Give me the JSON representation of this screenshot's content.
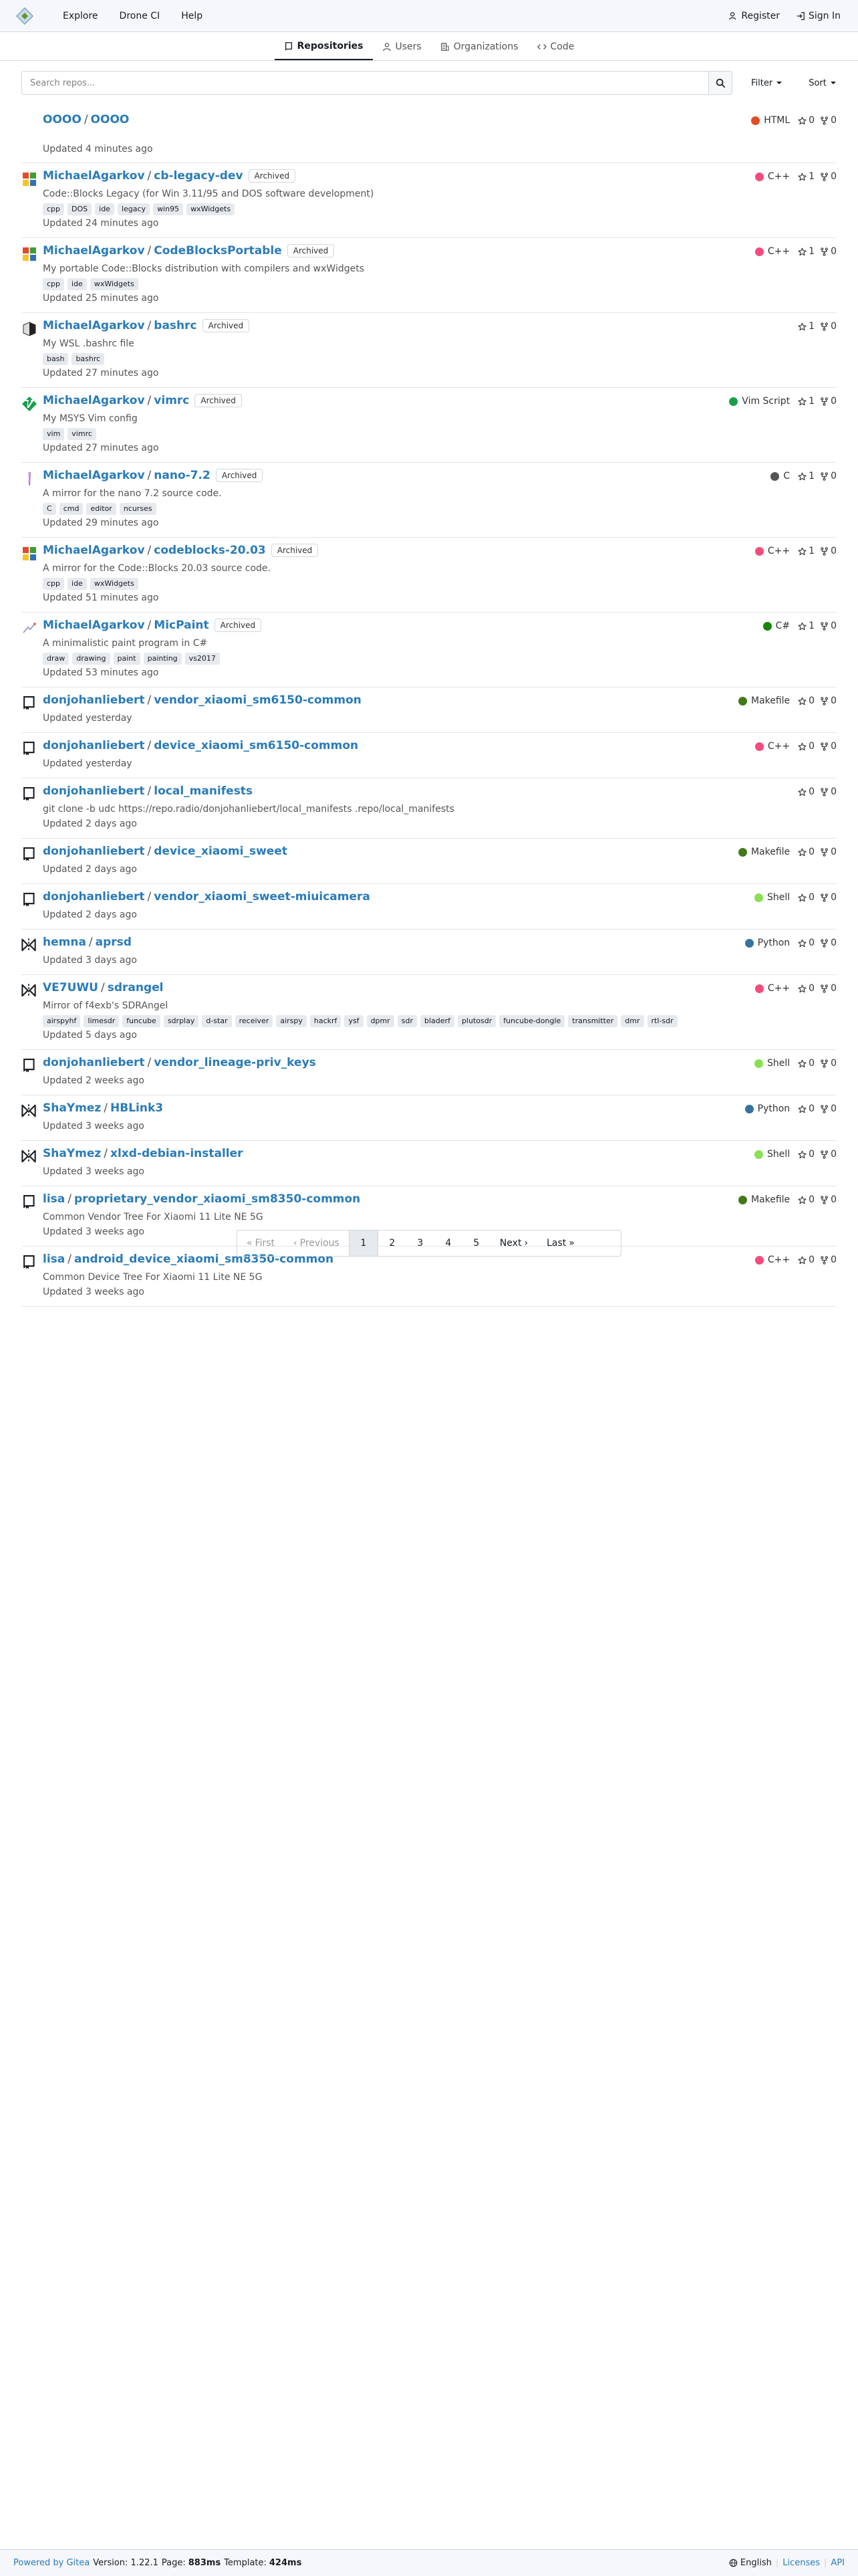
{
  "navbar": {
    "explore": "Explore",
    "drone_ci": "Drone CI",
    "help": "Help",
    "register": "Register",
    "sign_in": "Sign In"
  },
  "tabs": [
    {
      "label": "Repositories",
      "icon": "repo-icon",
      "active": true
    },
    {
      "label": "Users",
      "icon": "person-icon",
      "active": false
    },
    {
      "label": "Organizations",
      "icon": "organization-icon",
      "active": false
    },
    {
      "label": "Code",
      "icon": "code-icon",
      "active": false
    }
  ],
  "search": {
    "placeholder": "Search repos...",
    "value": ""
  },
  "filter": {
    "label": "Filter"
  },
  "sort": {
    "label": "Sort"
  },
  "colors": {
    "link": "#2a7bb8",
    "HTML": "#e34c26",
    "C++": "#f34b7d",
    "Vim Script": "#199f4b",
    "C": "#555555",
    "C#": "#178600",
    "Makefile": "#427819",
    "Shell": "#89e051",
    "Python": "#3572a5"
  },
  "repos": [
    {
      "owner": "OOOO",
      "name": "OOOO",
      "archived": false,
      "desc": "",
      "topics": [],
      "updated": "Updated 4 minutes ago",
      "lang": "HTML",
      "stars": "0",
      "forks": "0",
      "avatar": "blank"
    },
    {
      "owner": "MichaelAgarkov",
      "name": "cb-legacy-dev",
      "archived": true,
      "desc": "Code::Blocks Legacy (for Win 3.11/95 and DOS software development)",
      "topics": [
        "cpp",
        "DOS",
        "ide",
        "legacy",
        "win95",
        "wxWidgets"
      ],
      "updated": "Updated 24 minutes ago",
      "lang": "C++",
      "stars": "1",
      "forks": "0",
      "avatar": "codeblocks"
    },
    {
      "owner": "MichaelAgarkov",
      "name": "CodeBlocksPortable",
      "archived": true,
      "desc": "My portable Code::Blocks distribution with compilers and wxWidgets",
      "topics": [
        "cpp",
        "ide",
        "wxWidgets"
      ],
      "updated": "Updated 25 minutes ago",
      "lang": "C++",
      "stars": "1",
      "forks": "0",
      "avatar": "codeblocks"
    },
    {
      "owner": "MichaelAgarkov",
      "name": "bashrc",
      "archived": true,
      "desc": "My WSL .bashrc file",
      "topics": [
        "bash",
        "bashrc"
      ],
      "updated": "Updated 27 minutes ago",
      "lang": "",
      "stars": "1",
      "forks": "0",
      "avatar": "terminal"
    },
    {
      "owner": "MichaelAgarkov",
      "name": "vimrc",
      "archived": true,
      "desc": "My MSYS Vim config",
      "topics": [
        "vim",
        "vimrc"
      ],
      "updated": "Updated 27 minutes ago",
      "lang": "Vim Script",
      "stars": "1",
      "forks": "0",
      "avatar": "vim"
    },
    {
      "owner": "MichaelAgarkov",
      "name": "nano-7.2",
      "archived": true,
      "desc": "A mirror for the nano 7.2 source code.",
      "topics": [
        "C",
        "cmd",
        "editor",
        "ncurses"
      ],
      "updated": "Updated 29 minutes ago",
      "lang": "C",
      "stars": "1",
      "forks": "0",
      "avatar": "nano"
    },
    {
      "owner": "MichaelAgarkov",
      "name": "codeblocks-20.03",
      "archived": true,
      "desc": "A mirror for the Code::Blocks 20.03 source code.",
      "topics": [
        "cpp",
        "ide",
        "wxWidgets"
      ],
      "updated": "Updated 51 minutes ago",
      "lang": "C++",
      "stars": "1",
      "forks": "0",
      "avatar": "codeblocks"
    },
    {
      "owner": "MichaelAgarkov",
      "name": "MicPaint",
      "archived": true,
      "desc": "A minimalistic paint program in C#",
      "topics": [
        "draw",
        "drawing",
        "paint",
        "painting",
        "vs2017"
      ],
      "updated": "Updated 53 minutes ago",
      "lang": "C#",
      "stars": "1",
      "forks": "0",
      "avatar": "paint"
    },
    {
      "owner": "donjohanliebert",
      "name": "vendor_xiaomi_sm6150-common",
      "archived": false,
      "desc": "",
      "topics": [],
      "updated": "Updated yesterday",
      "lang": "Makefile",
      "stars": "0",
      "forks": "0",
      "avatar": "repo"
    },
    {
      "owner": "donjohanliebert",
      "name": "device_xiaomi_sm6150-common",
      "archived": false,
      "desc": "",
      "topics": [],
      "updated": "Updated yesterday",
      "lang": "C++",
      "stars": "0",
      "forks": "0",
      "avatar": "repo"
    },
    {
      "owner": "donjohanliebert",
      "name": "local_manifests",
      "archived": false,
      "desc": "git clone -b udc https://repo.radio/donjohanliebert/local_manifests .repo/local_manifests",
      "topics": [],
      "updated": "Updated 2 days ago",
      "lang": "",
      "stars": "0",
      "forks": "0",
      "avatar": "repo"
    },
    {
      "owner": "donjohanliebert",
      "name": "device_xiaomi_sweet",
      "archived": false,
      "desc": "",
      "topics": [],
      "updated": "Updated 2 days ago",
      "lang": "Makefile",
      "stars": "0",
      "forks": "0",
      "avatar": "repo"
    },
    {
      "owner": "donjohanliebert",
      "name": "vendor_xiaomi_sweet-miuicamera",
      "archived": false,
      "desc": "",
      "topics": [],
      "updated": "Updated 2 days ago",
      "lang": "Shell",
      "stars": "0",
      "forks": "0",
      "avatar": "repo"
    },
    {
      "owner": "hemna",
      "name": "aprsd",
      "archived": false,
      "desc": "",
      "topics": [],
      "updated": "Updated 3 days ago",
      "lang": "Python",
      "stars": "0",
      "forks": "0",
      "avatar": "mirror"
    },
    {
      "owner": "VE7UWU",
      "name": "sdrangel",
      "archived": false,
      "desc": "Mirror of f4exb's SDRAngel",
      "topics": [
        "airspyhf",
        "limesdr",
        "funcube",
        "sdrplay",
        "d-star",
        "receiver",
        "airspy",
        "hackrf",
        "ysf",
        "dpmr",
        "sdr",
        "bladerf",
        "plutosdr",
        "funcube-dongle",
        "transmitter",
        "dmr",
        "rtl-sdr"
      ],
      "updated": "Updated 5 days ago",
      "lang": "C++",
      "stars": "0",
      "forks": "0",
      "avatar": "mirror"
    },
    {
      "owner": "donjohanliebert",
      "name": "vendor_lineage-priv_keys",
      "archived": false,
      "desc": "",
      "topics": [],
      "updated": "Updated 2 weeks ago",
      "lang": "Shell",
      "stars": "0",
      "forks": "0",
      "avatar": "repo"
    },
    {
      "owner": "ShaYmez",
      "name": "HBLink3",
      "archived": false,
      "desc": "",
      "topics": [],
      "updated": "Updated 3 weeks ago",
      "lang": "Python",
      "stars": "0",
      "forks": "0",
      "avatar": "mirror"
    },
    {
      "owner": "ShaYmez",
      "name": "xlxd-debian-installer",
      "archived": false,
      "desc": "",
      "topics": [],
      "updated": "Updated 3 weeks ago",
      "lang": "Shell",
      "stars": "0",
      "forks": "0",
      "avatar": "mirror"
    },
    {
      "owner": "lisa",
      "name": "proprietary_vendor_xiaomi_sm8350-common",
      "archived": false,
      "desc": "Common Vendor Tree For Xiaomi 11 Lite NE 5G",
      "topics": [],
      "updated": "Updated 3 weeks ago",
      "lang": "Makefile",
      "stars": "0",
      "forks": "0",
      "avatar": "repo"
    },
    {
      "owner": "lisa",
      "name": "android_device_xiaomi_sm8350-common",
      "archived": false,
      "desc": "Common Device Tree For Xiaomi 11 Lite NE 5G",
      "topics": [],
      "updated": "Updated 3 weeks ago",
      "lang": "C++",
      "stars": "0",
      "forks": "0",
      "avatar": "repo"
    }
  ],
  "archived_label": "Archived",
  "pagination": {
    "first": "First",
    "previous": "Previous",
    "pages": [
      "1",
      "2",
      "3",
      "4",
      "5"
    ],
    "current": "1",
    "next": "Next",
    "last": "Last"
  },
  "footer": {
    "powered_by": "Powered by Gitea",
    "version_label": "Version: 1.22.1",
    "page_label": "Page:",
    "page_time": "883ms",
    "template_label": "Template:",
    "template_time": "424ms",
    "language": "English",
    "licenses": "Licenses",
    "api": "API"
  }
}
